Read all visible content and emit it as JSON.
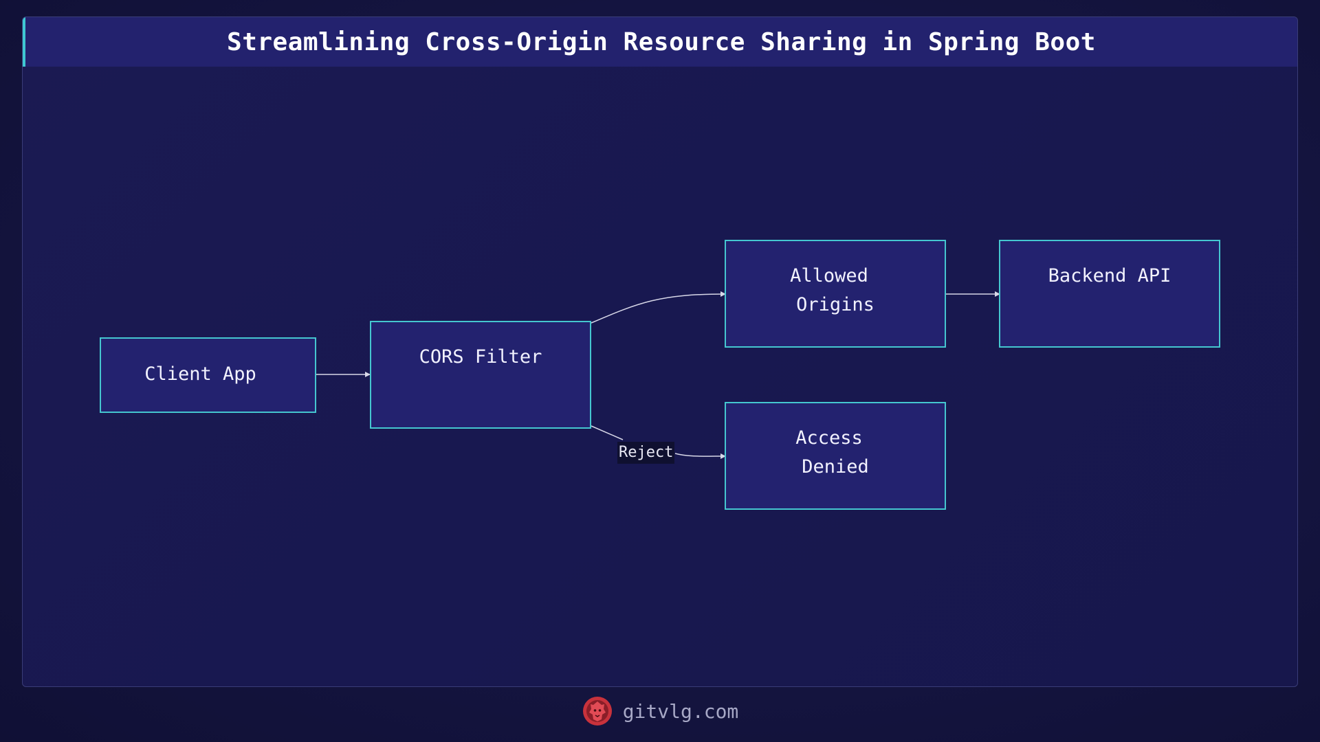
{
  "header": {
    "title": "Streamlining Cross-Origin Resource Sharing in Spring Boot"
  },
  "nodes": {
    "client_app": "Client App",
    "cors_filter": "CORS Filter",
    "allowed_origins": [
      "Allowed",
      "Origins"
    ],
    "backend_api": "Backend API",
    "access_denied": [
      "Access",
      "Denied"
    ]
  },
  "edges": {
    "reject_label": "Reject"
  },
  "footer": {
    "site": "gitvlg.com",
    "logo_icon": "lion-logo-icon"
  },
  "colors": {
    "accent": "#45c7d0",
    "node_fill": "#23226f",
    "header_fill": "#23226e",
    "logo": "#c8323c"
  }
}
